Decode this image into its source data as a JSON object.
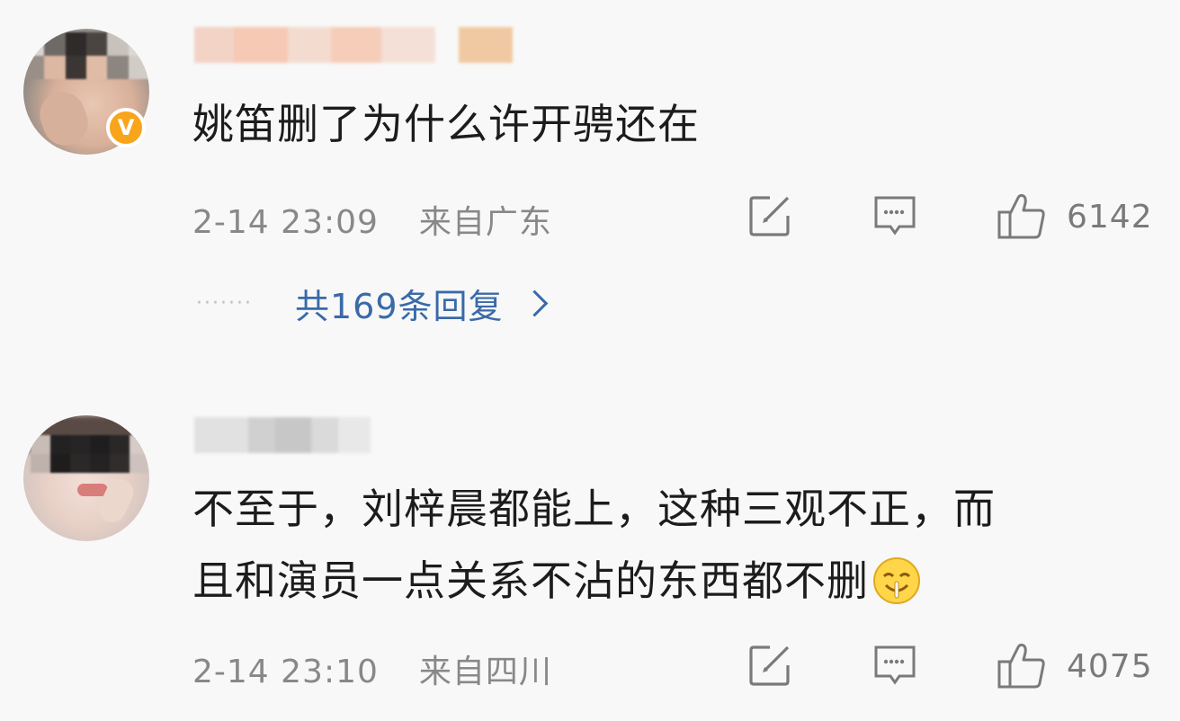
{
  "comments": [
    {
      "text": "姚笛删了为什么许开骋还在",
      "time": "2-14 23:09",
      "location": "来自广东",
      "likes": "6142",
      "replies_label": "共169条回复",
      "verified_badge": "V",
      "avatar_icon": "blurred-avatar",
      "share_icon": "share-icon",
      "comment_icon": "comment-icon",
      "like_icon": "thumbs-up-icon"
    },
    {
      "text_line1": "不至于，刘梓晨都能上，这种三观不正，而",
      "text_line2": "且和演员一点关系不沾的东西都不删",
      "emoji": "smirk-emoji",
      "time": "2-14 23:10",
      "location": "来自四川",
      "likes": "4075",
      "avatar_icon": "blurred-avatar",
      "share_icon": "share-icon",
      "comment_icon": "comment-icon",
      "like_icon": "thumbs-up-icon"
    }
  ],
  "colors": {
    "background": "#f8f8f8",
    "text": "#1c1c1c",
    "meta": "#888888",
    "link": "#3a6aa8",
    "badge": "#f8a51b"
  }
}
